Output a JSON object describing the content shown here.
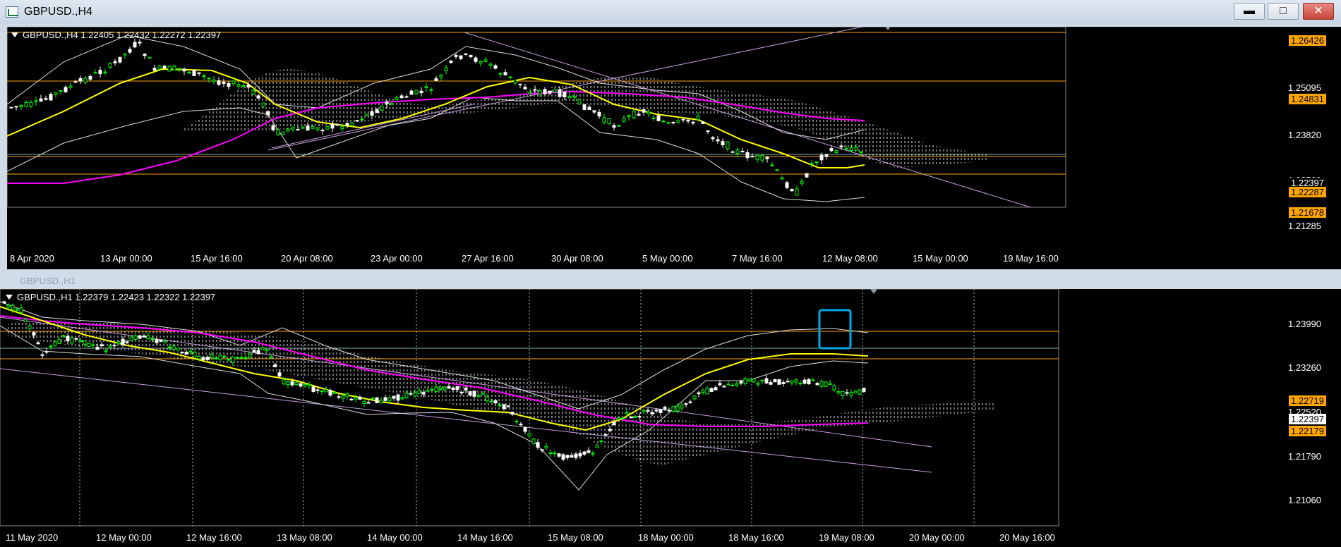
{
  "window_top": {
    "title": "GBPUSD.,H4",
    "controls": {
      "minimize": "▬",
      "maximize": "□",
      "close": "✕"
    },
    "ohlc_text": "GBPUSD.,H4  1.22405 1.22432 1.22272 1.22397",
    "price_scale": [
      "1.25095",
      "1.23820",
      "1.22560",
      "1.21285"
    ],
    "price_labels": [
      {
        "text": "1.26426",
        "bg": "#ffa500",
        "fg": "#000000"
      },
      {
        "text": "1.24831",
        "bg": "#ffa500",
        "fg": "#000000"
      },
      {
        "text": "1.22397",
        "bg": "#000000",
        "fg": "#ffffff"
      },
      {
        "text": "1.22287",
        "bg": "#ffa500",
        "fg": "#000000"
      },
      {
        "text": "1.21678",
        "bg": "#ffa500",
        "fg": "#000000"
      }
    ],
    "time_labels": [
      "8 Apr 2020",
      "13 Apr 00:00",
      "15 Apr 16:00",
      "20 Apr 08:00",
      "23 Apr 00:00",
      "27 Apr 16:00",
      "30 Apr 08:00",
      "5 May 00:00",
      "7 May 16:00",
      "12 May 08:00",
      "15 May 00:00",
      "19 May 16:00"
    ]
  },
  "window_bottom": {
    "title": "GBPUSD.,H1",
    "ohlc_text": "GBPUSD.,H1  1.22379 1.22423 1.22322 1.22397",
    "price_scale": [
      "1.23990",
      "1.23260",
      "1.22520",
      "1.21790",
      "1.21060"
    ],
    "price_labels": [
      {
        "text": "1.22719",
        "bg": "#ffa500",
        "fg": "#000000"
      },
      {
        "text": "1.22397",
        "bg": "#ffffff",
        "fg": "#000000"
      },
      {
        "text": "1.22179",
        "bg": "#ffa500",
        "fg": "#000000"
      }
    ],
    "time_labels": [
      "11 May 2020",
      "12 May 00:00",
      "12 May 16:00",
      "13 May 08:00",
      "14 May 00:00",
      "14 May 16:00",
      "15 May 08:00",
      "18 May 00:00",
      "18 May 16:00",
      "19 May 08:00",
      "20 May 00:00",
      "20 May 16:00"
    ]
  },
  "colors": {
    "bull": "#00ff00",
    "bear": "#ffffff",
    "ma_fast": "#ffff00",
    "ma_slow": "#ff00ff",
    "levels": "#ffa500",
    "channel": "#c8a0dc",
    "highlight_box": "#00a8e8"
  }
}
